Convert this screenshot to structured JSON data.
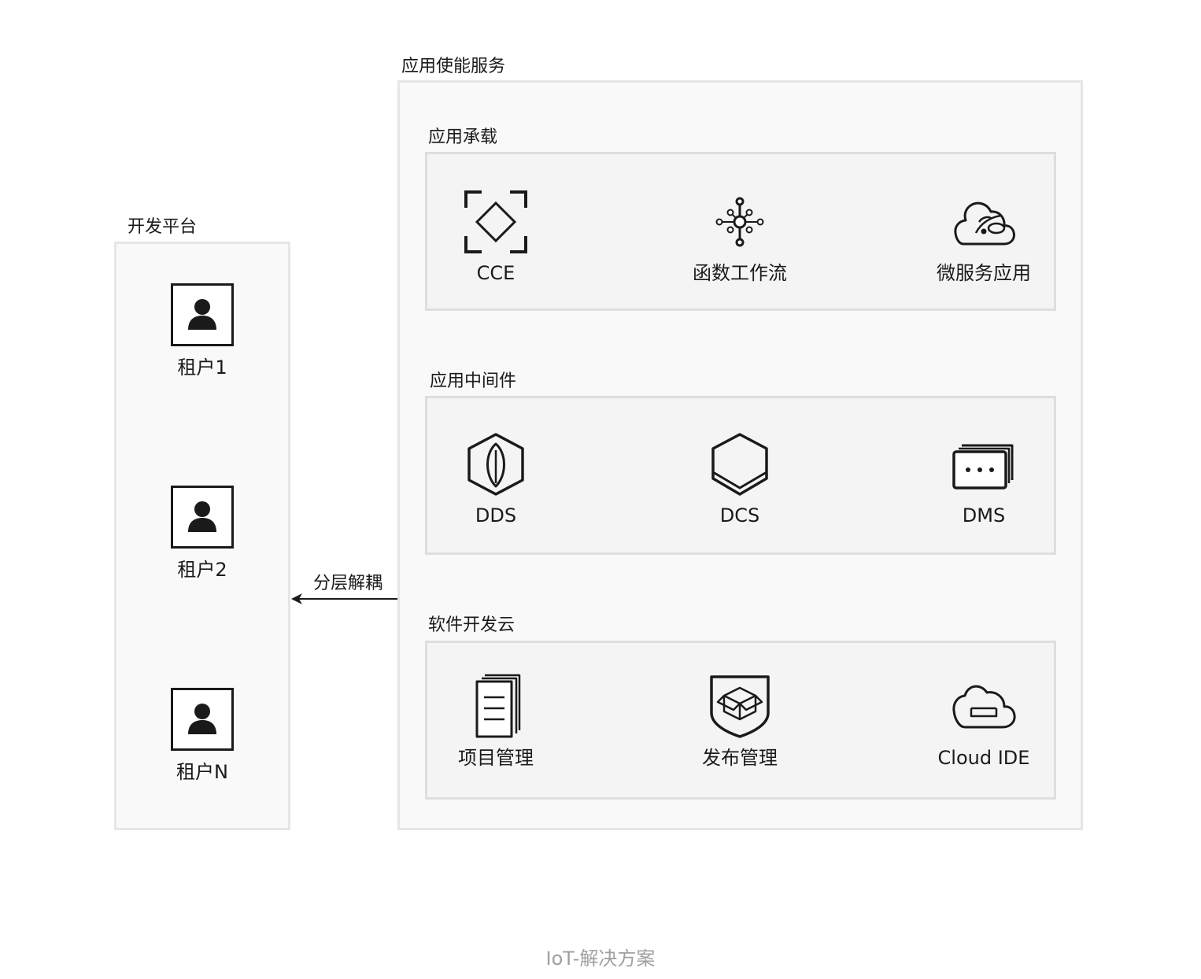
{
  "dev_platform": {
    "title": "开发平台",
    "tenants": [
      {
        "label": "租户1",
        "icon": "user-icon"
      },
      {
        "label": "租户2",
        "icon": "user-icon"
      },
      {
        "label": "租户N",
        "icon": "user-icon"
      }
    ]
  },
  "connector": {
    "label": "分层解耦",
    "direction": "right-to-left"
  },
  "app_enablement": {
    "title": "应用使能服务",
    "groups": [
      {
        "title": "应用承载",
        "items": [
          {
            "label": "CCE",
            "icon": "cce-icon"
          },
          {
            "label": "函数工作流",
            "icon": "function-workflow-icon"
          },
          {
            "label": "微服务应用",
            "icon": "microservice-cloud-icon"
          }
        ]
      },
      {
        "title": "应用中间件",
        "items": [
          {
            "label": "DDS",
            "icon": "dds-leaf-hexagon-icon"
          },
          {
            "label": "DCS",
            "icon": "dcs-hexagon-icon"
          },
          {
            "label": "DMS",
            "icon": "dms-message-icon"
          }
        ]
      },
      {
        "title": "软件开发云",
        "items": [
          {
            "label": "项目管理",
            "icon": "project-document-icon"
          },
          {
            "label": "发布管理",
            "icon": "release-package-icon"
          },
          {
            "label": "Cloud IDE",
            "icon": "cloud-ide-icon"
          }
        ]
      }
    ]
  },
  "caption": "IoT-解决方案",
  "colors": {
    "outer_fill": "#f9f9f9",
    "outer_border": "#e6e6e6",
    "inner_fill": "#f4f4f4",
    "inner_border": "#dedede",
    "stroke": "#1a1a1a",
    "caption": "#a0a0a0"
  }
}
